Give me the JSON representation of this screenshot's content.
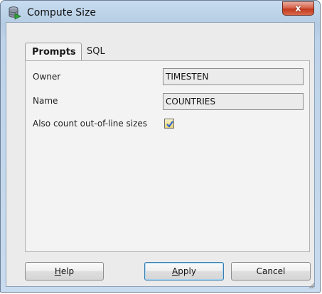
{
  "window": {
    "title": "Compute Size",
    "close_label": "x",
    "icon": "database-compute-icon"
  },
  "tabs": [
    {
      "label": "Prompts",
      "active": true
    },
    {
      "label": "SQL",
      "active": false
    }
  ],
  "form": {
    "owner_label": "Owner",
    "owner_value": "TIMESTEN",
    "name_label": "Name",
    "name_value": "COUNTRIES",
    "outofline_label": "Also count out-of-line sizes",
    "outofline_checked": true
  },
  "buttons": {
    "help": "Help",
    "help_mnemonic": "H",
    "apply": "Apply",
    "apply_mnemonic": "A",
    "cancel": "Cancel"
  },
  "colors": {
    "title_gradient_top": "#c7dcef",
    "close_red": "#c23a1f",
    "checkbox_fill": "#e6d37a",
    "check_mark": "#2a5cc8"
  }
}
